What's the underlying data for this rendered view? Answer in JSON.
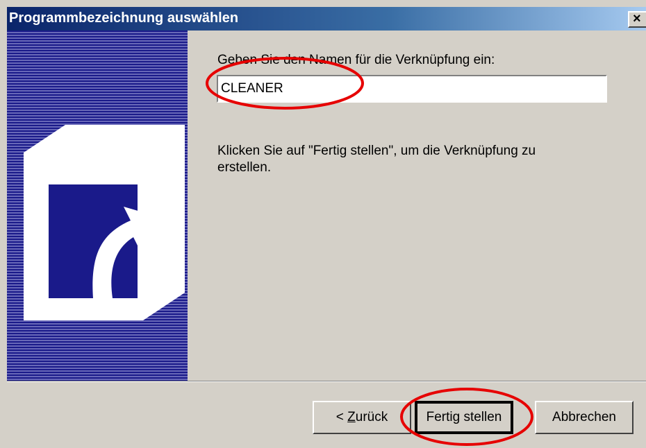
{
  "dialog": {
    "title": "Programmbezeichnung auswählen",
    "close_label": "×"
  },
  "content": {
    "prompt": "Geben Sie den Namen für die Verknüpfung ein:",
    "name_value": "CLEANER",
    "hint": "Klicken Sie auf \"Fertig stellen\", um die Verknüpfung zu erstellen."
  },
  "buttons": {
    "back_prefix": "< ",
    "back_accel": "Z",
    "back_rest": "urück",
    "finish": "Fertig stellen",
    "cancel": "Abbrechen"
  },
  "colors": {
    "titlebar_start": "#0a246a",
    "titlebar_end": "#a6caf0",
    "dialog_bg": "#d4d0c8",
    "sidebar": "#1a1a8a",
    "annotation": "#e60000"
  },
  "icons": {
    "sidebar": "shortcut-arrow-icon"
  }
}
